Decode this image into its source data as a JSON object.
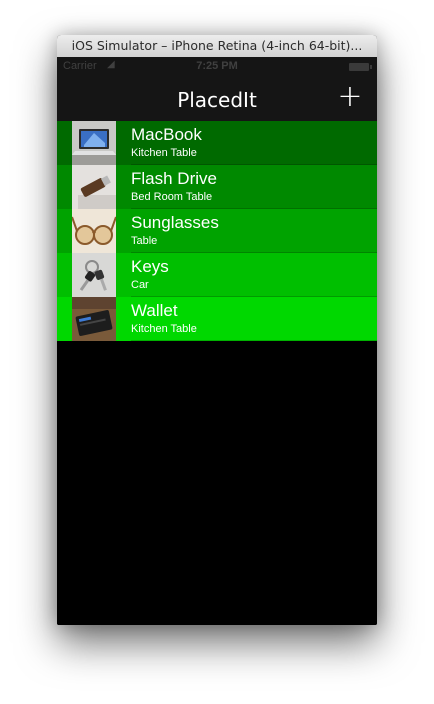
{
  "window": {
    "title": "iOS Simulator – iPhone Retina (4-inch 64-bit)..."
  },
  "status_bar": {
    "carrier": "Carrier",
    "time": "7:25 PM"
  },
  "nav": {
    "title": "PlacedIt",
    "add_label": "+"
  },
  "items": [
    {
      "name": "MacBook",
      "place": "Kitchen Table",
      "color": "#006a00",
      "icon": "laptop-thumbnail"
    },
    {
      "name": "Flash Drive",
      "place": "Bed Room Table",
      "color": "#008900",
      "icon": "flash-drive-thumbnail"
    },
    {
      "name": "Sunglasses",
      "place": "Table",
      "color": "#00a300",
      "icon": "sunglasses-thumbnail"
    },
    {
      "name": "Keys",
      "place": "Car",
      "color": "#00bf00",
      "icon": "keys-thumbnail"
    },
    {
      "name": "Wallet",
      "place": "Kitchen Table",
      "color": "#00d800",
      "icon": "wallet-thumbnail"
    }
  ]
}
